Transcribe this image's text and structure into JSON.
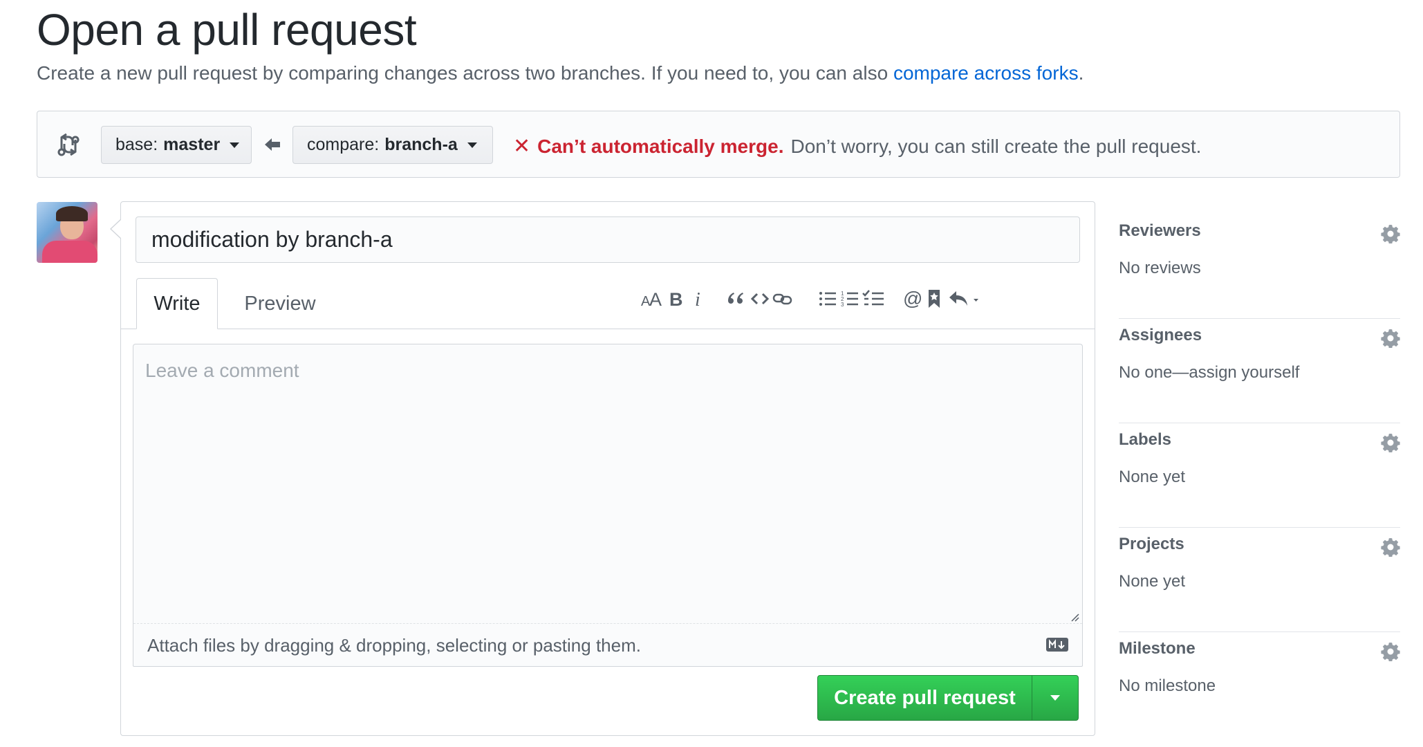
{
  "header": {
    "title": "Open a pull request",
    "subtitle_prefix": "Create a new pull request by comparing changes across two branches. If you need to, you can also ",
    "subtitle_link": "compare across forks",
    "subtitle_suffix": "."
  },
  "range": {
    "base_prefix": "base:",
    "base_branch": "master",
    "compare_prefix": "compare:",
    "compare_branch": "branch-a",
    "merge_error": "Can’t automatically merge.",
    "merge_hint": "Don’t worry, you can still create the pull request."
  },
  "editor": {
    "title_value": "modification by branch-a",
    "tabs": [
      {
        "label": "Write"
      },
      {
        "label": "Preview"
      }
    ],
    "comment_placeholder": "Leave a comment",
    "attach_text": "Attach files by dragging & dropping, selecting or pasting them.",
    "submit_label": "Create pull request",
    "toolbar_icons": [
      "header-icon",
      "bold-icon",
      "italic-icon",
      "quote-icon",
      "code-icon",
      "link-icon",
      "bulleted-list-icon",
      "numbered-list-icon",
      "task-list-icon",
      "mention-icon",
      "reference-icon",
      "reply-icon"
    ]
  },
  "sidebar": {
    "sections": [
      {
        "title": "Reviewers",
        "value": "No reviews"
      },
      {
        "title": "Assignees",
        "value": "No one—assign yourself"
      },
      {
        "title": "Labels",
        "value": "None yet"
      },
      {
        "title": "Projects",
        "value": "None yet"
      },
      {
        "title": "Milestone",
        "value": "No milestone"
      }
    ]
  },
  "colors": {
    "link": "#0366d6",
    "error": "#cb2431",
    "primary_button": "#28a745"
  }
}
